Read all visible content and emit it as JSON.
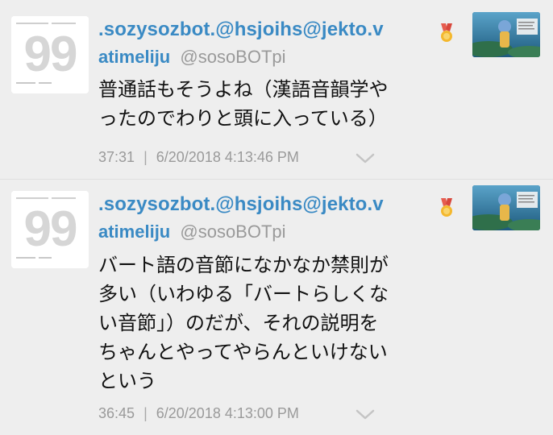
{
  "posts": [
    {
      "name": ".sozysozbot.@hsjoihs@jekto.v",
      "display_name": "atimeliju",
      "screen_name": "@sosoBOTpi",
      "text": "普通話もそうよね（漢語音韻学や\nったのでわりと頭に入っている）",
      "elapsed": "37:31",
      "timestamp": "6/20/2018 4:13:46 PM",
      "avatar_text": "99",
      "badge_icon": "ribbon-medal-icon",
      "menu_icon": "chevron-down-icon"
    },
    {
      "name": ".sozysozbot.@hsjoihs@jekto.v",
      "display_name": "atimeliju",
      "screen_name": "@sosoBOTpi",
      "text": "バート語の音節になかなか禁則が\n多い（いわゆる「バートらしくな\nい音節」）のだが、それの説明を\nちゃんとやってやらんといけない\nという",
      "elapsed": "36:45",
      "timestamp": "6/20/2018 4:13:00 PM",
      "avatar_text": "99",
      "badge_icon": "ribbon-medal-icon",
      "menu_icon": "chevron-down-icon"
    }
  ],
  "separator": "|",
  "colors": {
    "link": "#3a8ac4",
    "muted": "#9a9a9a",
    "text": "#111111",
    "background": "#eeeeee"
  }
}
